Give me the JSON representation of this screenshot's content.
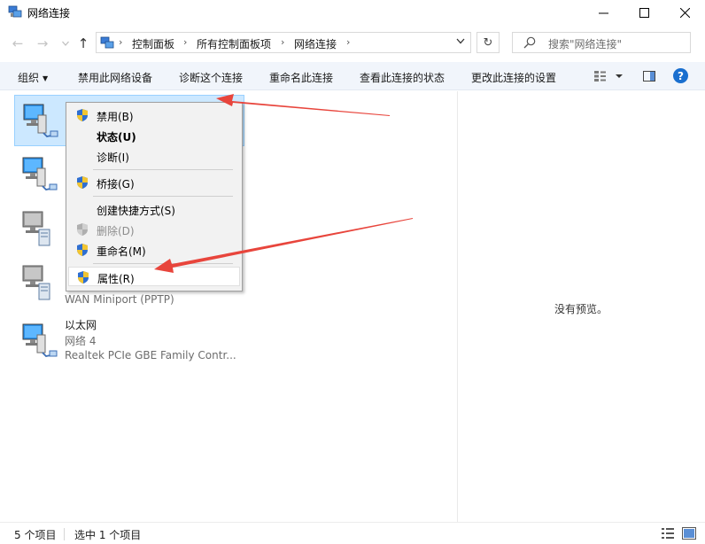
{
  "window": {
    "title": "网络连接",
    "minimize_glyph": "—",
    "maximize_glyph": "☐",
    "close_glyph": "✕"
  },
  "nav": {
    "back_glyph": "←",
    "forward_glyph": "→",
    "up_glyph": "↑",
    "recent_glyph": "⌄"
  },
  "address": {
    "breadcrumbs": [
      "控制面板",
      "所有控制面板项",
      "网络连接"
    ],
    "separator": "›",
    "refresh_glyph": "↻"
  },
  "search": {
    "placeholder": "搜索\"网络连接\""
  },
  "toolbar": {
    "organize": "组织",
    "disable_device": "禁用此网络设备",
    "diagnose": "诊断这个连接",
    "rename": "重命名此连接",
    "view_status": "查看此连接的状态",
    "change_settings": "更改此连接的设置",
    "help": "?"
  },
  "connections": [
    {
      "name": "",
      "line2": "",
      "line3": "",
      "selected": true
    },
    {
      "name": "",
      "line2": "",
      "line3": ""
    },
    {
      "name": "",
      "line2": "",
      "line3": ""
    },
    {
      "name": "",
      "line2": "",
      "line3": "WAN Miniport (PPTP)"
    },
    {
      "name": "以太网",
      "line2": "网络 4",
      "line3": "Realtek PCIe GBE Family Contr..."
    }
  ],
  "context_menu": {
    "items": [
      {
        "label": "禁用(B)",
        "shield": true
      },
      {
        "label": "状态(U)",
        "bold": true
      },
      {
        "label": "诊断(I)"
      },
      {
        "label": "桥接(G)",
        "shield": true
      },
      {
        "label": "创建快捷方式(S)"
      },
      {
        "label": "删除(D)",
        "shield": true,
        "disabled": true
      },
      {
        "label": "重命名(M)",
        "shield": true
      },
      {
        "label": "属性(R)",
        "shield": true,
        "highlighted": true
      }
    ]
  },
  "preview": {
    "empty_text": "没有预览。"
  },
  "status": {
    "item_count": "5 个项目",
    "selected_count": "选中 1 个项目"
  },
  "colors": {
    "toolbar_bg": "#f1f5fb",
    "selection_bg": "#cce8ff",
    "annotation_arrow": "#e8453c",
    "help_blue": "#1a6fcf"
  }
}
